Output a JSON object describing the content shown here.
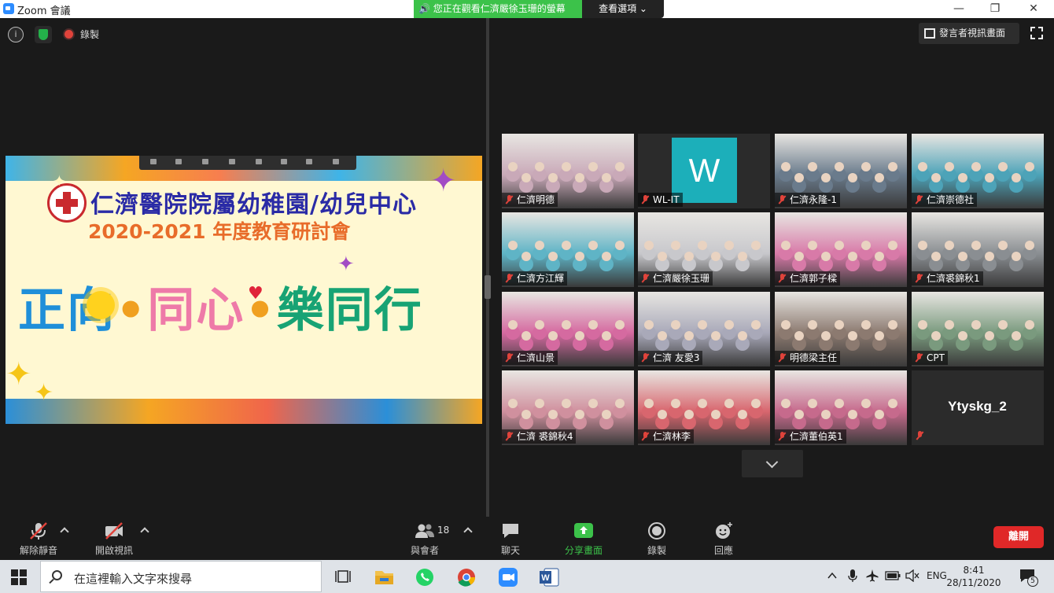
{
  "window": {
    "title": "Zoom 會議",
    "share_banner": "您正在觀看仁濟嚴徐玉珊的螢幕",
    "view_options": "查看選項 ⌄",
    "minimize": "—",
    "restore": "❐",
    "close": "✕"
  },
  "meeting_bar": {
    "info_glyph": "i",
    "recording_label": "錄製",
    "speaker_view_label": "發言者視訊畫面"
  },
  "slide": {
    "title_line1": "仁濟醫院院屬幼稚園/幼兒中心",
    "title_line2": "2020-2021  年度教育研討會",
    "slogan_part1": "正向",
    "slogan_dot": "•",
    "slogan_part2": "同心",
    "slogan_part3": "樂同行"
  },
  "participants": [
    {
      "name": "仁濟明德",
      "type": "video",
      "color": "#c9a9b8"
    },
    {
      "name": "WL-IT",
      "type": "avatar",
      "initial": "W",
      "color": "#1cafba"
    },
    {
      "name": "仁濟永隆-1",
      "type": "video",
      "color": "#6a7b8c"
    },
    {
      "name": "仁濟崇德社",
      "type": "video",
      "color": "#4da3b8"
    },
    {
      "name": "仁濟方江輝",
      "type": "video",
      "color": "#5fb4c6"
    },
    {
      "name": "仁濟嚴徐玉珊",
      "type": "video",
      "active": true,
      "color": "#c8c8cc"
    },
    {
      "name": "仁濟郭子樑",
      "type": "video",
      "color": "#d87aa8"
    },
    {
      "name": "仁濟裘錦秋1",
      "type": "video",
      "color": "#8a8e92"
    },
    {
      "name": "仁濟山景",
      "type": "video",
      "color": "#d56aa0"
    },
    {
      "name": "仁濟 友愛3",
      "type": "video",
      "color": "#a9a9b9"
    },
    {
      "name": "明德梁主任",
      "type": "video",
      "color": "#8c7a70"
    },
    {
      "name": "CPT",
      "type": "video",
      "color": "#7a9a7e"
    },
    {
      "name": "仁濟 裘錦秋4",
      "type": "video",
      "color": "#d0909e"
    },
    {
      "name": "仁濟林李",
      "type": "video",
      "color": "#d8666e"
    },
    {
      "name": "仁濟董伯英1",
      "type": "video",
      "color": "#c66a8c"
    },
    {
      "name": "Ytyskg_2",
      "type": "name_only"
    }
  ],
  "toolbar": {
    "unmute": "解除靜音",
    "start_video": "開啟視訊",
    "participants": "與會者",
    "participant_count": "18",
    "chat": "聊天",
    "share_screen": "分享畫面",
    "record": "錄製",
    "reactions": "回應",
    "leave": "離開"
  },
  "taskbar": {
    "search_placeholder": "在這裡輸入文字來搜尋",
    "lang": "ENG",
    "time": "8:41",
    "date": "28/11/2020",
    "notifications": "5"
  }
}
